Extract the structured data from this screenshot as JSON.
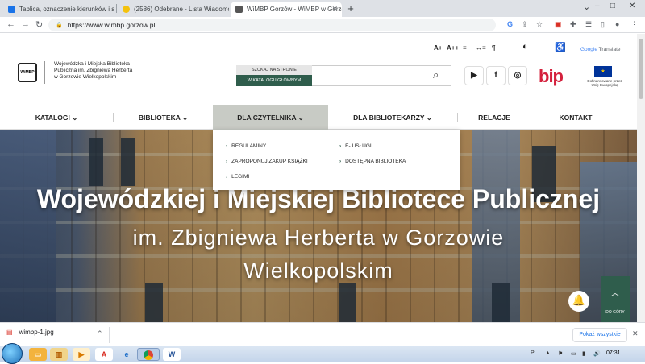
{
  "browser": {
    "tabs": [
      {
        "title": "Tablica, oznaczenie kierunków i st",
        "favicon_color": "#1a73e8"
      },
      {
        "title": "(2586) Odebrane - Lista Wiadomo",
        "favicon_color": "#f4c20d"
      },
      {
        "title": "WiMBP Gorzów - WiMBP w Gorzo",
        "favicon_color": "#555555",
        "active": true
      }
    ],
    "new_tab": "+",
    "url": "https://www.wimbp.gorzow.pl",
    "window_controls": {
      "minimize": "–",
      "maximize": "□",
      "close": "✕"
    },
    "toolbar_icons": [
      "google-icon",
      "share-icon",
      "star-icon",
      "pdf-icon",
      "extensions-icon",
      "reading-list-icon",
      "sidepanel-icon",
      "profile-icon",
      "menu-icon"
    ]
  },
  "header": {
    "logo_text_lines": [
      "Wojewódzka i Miejska Biblioteka",
      "Publiczna im. Zbigniewa Herberta",
      "w Gorzowie Wielkopolskim"
    ],
    "logo_badge": "WiMBP",
    "accessibility": [
      "A+",
      "A++",
      "≡",
      "↔≡",
      "¶"
    ],
    "google_translate": {
      "google": "Google",
      "label": "Translate"
    },
    "search": {
      "tab_inactive": "SZUKAJ NA STRONIE",
      "tab_active": "W KATALOGU GŁÓWNYM",
      "value": ""
    },
    "bip": "bip",
    "eu": {
      "flag": "★",
      "caption": "Dofinansowane przez Unię Europejską"
    },
    "social": [
      {
        "name": "youtube-icon",
        "glyph": "▶"
      },
      {
        "name": "facebook-icon",
        "glyph": "f"
      },
      {
        "name": "instagram-icon",
        "glyph": "◎"
      }
    ]
  },
  "nav": {
    "items": [
      {
        "label": "KATALOGI",
        "chevron": true
      },
      {
        "label": "BIBLIOTEKA",
        "chevron": true
      },
      {
        "label": "DLA CZYTELNIKA",
        "chevron": true,
        "open": true
      },
      {
        "label": "DLA BIBLIOTEKARZY",
        "chevron": true
      },
      {
        "label": "RELACJE",
        "chevron": false
      },
      {
        "label": "KONTAKT",
        "chevron": false
      }
    ],
    "dropdown": {
      "col1": [
        "REGULAMINY",
        "ZAPROPONUJ ZAKUP KSIĄŻKI",
        "LEGIMI"
      ],
      "col2": [
        "E- USŁUGI",
        "DOSTĘPNA BIBLIOTEKA"
      ]
    }
  },
  "hero": {
    "line1": "Wojewódzkiej i Miejskiej Bibliotece Publicznej",
    "line2": "im. Zbigniewa Herberta w Gorzowie",
    "line3": "Wielkopolskim"
  },
  "floating": {
    "to_top_label": "DO GÓRY",
    "to_top_arrow": "︿"
  },
  "downloads": {
    "file": "wimbp-1.jpg",
    "show_all": "Pokaż wszystkie"
  },
  "taskbar": {
    "clock": "07:31",
    "tray_lang": "PL"
  }
}
